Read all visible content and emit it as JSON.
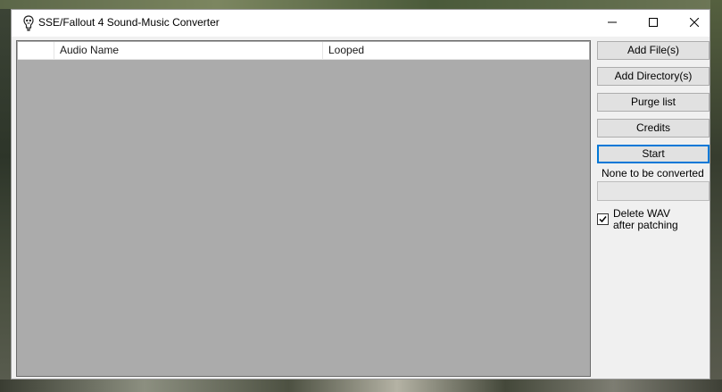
{
  "window": {
    "title": "SSE/Fallout 4 Sound-Music Converter",
    "controls": {
      "minimize": "minimize-icon",
      "maximize": "maximize-icon",
      "close": "close-icon"
    }
  },
  "list": {
    "columns": [
      "",
      "Audio Name",
      "Looped"
    ],
    "rows": []
  },
  "buttons": {
    "add_files": "Add File(s)",
    "add_directory": "Add Directory(s)",
    "purge_list": "Purge list",
    "credits": "Credits",
    "start": "Start"
  },
  "status": {
    "text": "None to be converted",
    "progress": 0
  },
  "options": {
    "delete_wav_line1": "Delete WAV",
    "delete_wav_line2": "after patching",
    "delete_wav_checked": true
  },
  "colors": {
    "accent": "#0078d7",
    "list_background": "#ababab",
    "window_background": "#f0f0f0"
  }
}
